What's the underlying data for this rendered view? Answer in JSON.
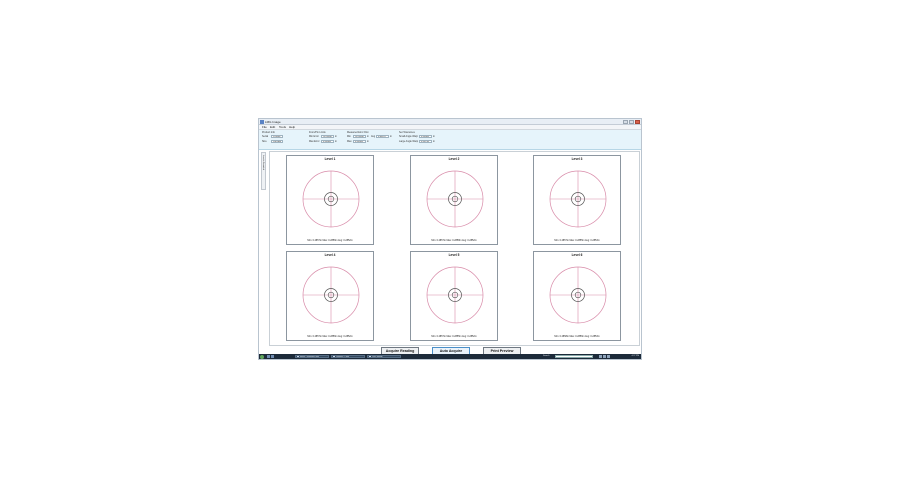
{
  "window": {
    "title": "LMG Image"
  },
  "menu": [
    "File",
    "Edit",
    "Tools",
    "Help"
  ],
  "header": {
    "product": {
      "title": "Product Info",
      "rows": [
        {
          "label": "Serial",
          "value": "123456"
        },
        {
          "label": "Size",
          "value": "100 mm"
        }
      ]
    },
    "from_lim": {
      "title": "From/Pin Limits",
      "rows": [
        {
          "label": "Min Error",
          "value": "-0.25000",
          "unit": "in"
        },
        {
          "label": "Max Error",
          "value": "0.25000",
          "unit": "in"
        }
      ]
    },
    "measured": {
      "title": "Measured Error Dist",
      "rows": [
        {
          "label": "Min",
          "value": "-0.25000",
          "unit": "in",
          "label2": "Avg",
          "value2": "0.00017",
          "unit2": "in"
        },
        {
          "label": "Max",
          "value": "0.25000",
          "unit": "in"
        }
      ]
    },
    "tol": {
      "title": "Set Tolerances",
      "rows": [
        {
          "label": "Small Angle Warp",
          "value": "0.25000",
          "unit": "in"
        },
        {
          "label": "Large Angle Warp",
          "value": "0.25750",
          "unit": "in"
        }
      ]
    }
  },
  "side_tab": {
    "label": "Levels Detailed"
  },
  "panels": [
    {
      "title": "Level 1",
      "stats": "Min: 0.2857in  Max: 0.2856in  Avg: 0.2852in"
    },
    {
      "title": "Level 2",
      "stats": "Min: 0.2857in  Max: 0.2858in  Avg: 0.2852in"
    },
    {
      "title": "Level 3",
      "stats": "Min: 0.2857in  Max: 0.2855in  Avg: 0.2853in"
    },
    {
      "title": "Level 4",
      "stats": "Min: 0.2857in  Max: 0.2856in  Avg: 0.2852in"
    },
    {
      "title": "Level 5",
      "stats": "Min: 0.2857in  Max: 0.2855in  Avg: 0.2852in"
    },
    {
      "title": "Level 6",
      "stats": "Min: 0.2858in  Max: 0.2856in  Avg: 0.2853in"
    }
  ],
  "buttons": {
    "acquire_reading": "Acquire Reading",
    "auto_acquire": "Auto Acquire",
    "print_preview": "Print Preview"
  },
  "taskbar": {
    "tasks": [
      "Inbox - Windows Mail",
      "Untitled - Paint",
      "LMG Image"
    ],
    "search_label": "Search",
    "clock": "4:27 PM"
  },
  "colors": {
    "outer_circle": "#d88aa8",
    "crosshair": "#d88aa8",
    "center_circles": "#555555",
    "header_bg": "#e6f4fb"
  }
}
